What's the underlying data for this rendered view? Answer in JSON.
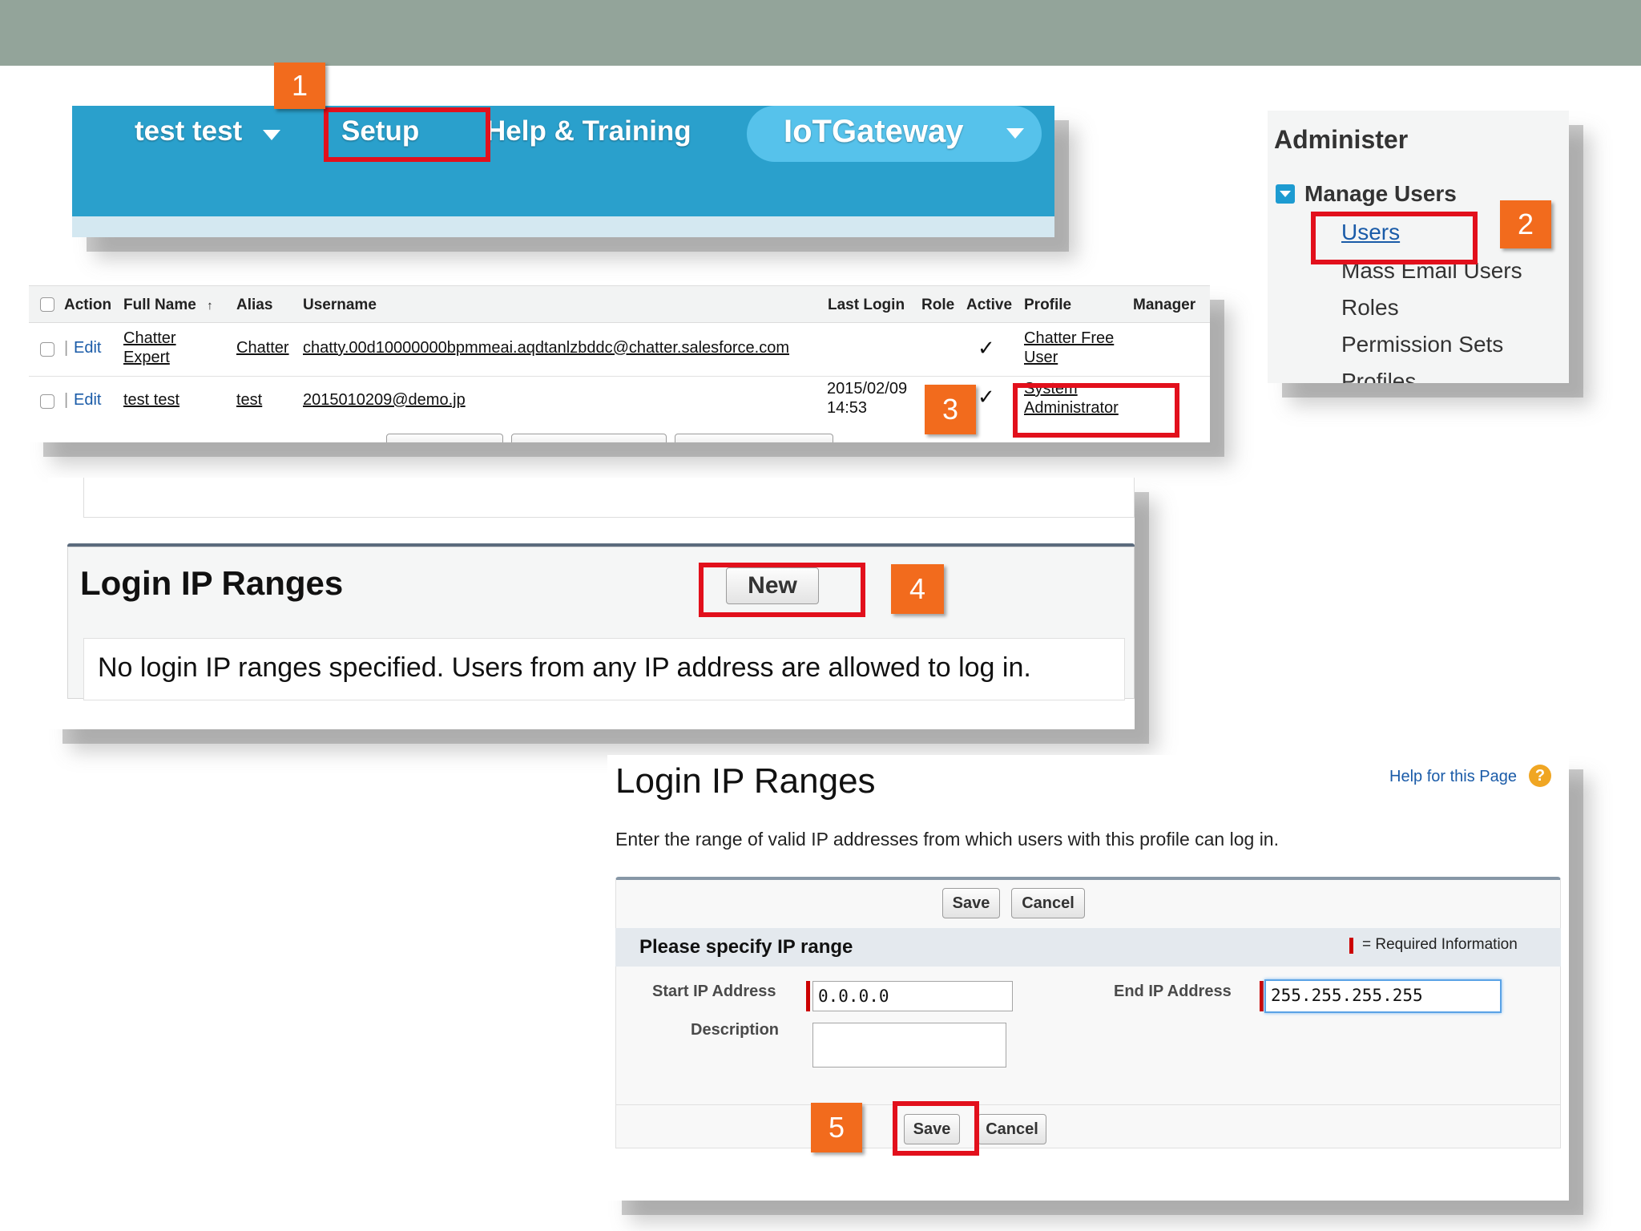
{
  "header": {
    "user_name": "test test",
    "setup_label": "Setup",
    "help_training_label": "Help & Training",
    "app_name": "IoTGateway"
  },
  "callouts": [
    "1",
    "2",
    "3",
    "4",
    "5"
  ],
  "admin_panel": {
    "title": "Administer",
    "section": "Manage Users",
    "items": [
      "Users",
      "Mass Email Users",
      "Roles",
      "Permission Sets",
      "Profiles"
    ]
  },
  "users_table": {
    "columns": [
      "Action",
      "Full Name",
      "Alias",
      "Username",
      "Last Login",
      "Role",
      "Active",
      "Profile",
      "Manager"
    ],
    "sort_indicator": "↑",
    "edit_label": "Edit",
    "active_mark": "✓",
    "rows": [
      {
        "full_name_line1": "Chatter",
        "full_name_line2": "Expert",
        "alias": "Chatter",
        "username": "chatty.00d10000000bpmmeai.aqdtanlzbddc@chatter.salesforce.com",
        "last_login_date": "",
        "last_login_time": "",
        "profile_line1": "Chatter Free",
        "profile_line2": "User"
      },
      {
        "full_name_line1": "test test",
        "full_name_line2": "",
        "alias": "test",
        "username": "2015010209@demo.jp",
        "last_login_date": "2015/02/09",
        "last_login_time": "14:53",
        "profile_line1": "System",
        "profile_line2": "Administrator"
      }
    ]
  },
  "login_ip_panel": {
    "title": "Login IP Ranges",
    "new_button": "New",
    "empty_message": "No login IP ranges specified. Users from any IP address are allowed to log in."
  },
  "ip_form": {
    "title": "Login IP Ranges",
    "help_link": "Help for this Page",
    "help_icon_glyph": "?",
    "description": "Enter the range of valid IP addresses from which users with this profile can log in.",
    "save_label": "Save",
    "cancel_label": "Cancel",
    "section_title": "Please specify IP range",
    "required_legend": "= Required Information",
    "start_ip_label": "Start IP Address",
    "start_ip_value": "0.0.0.0",
    "end_ip_label": "End IP Address",
    "end_ip_value": "255.255.255.255",
    "description_label": "Description",
    "description_value": ""
  },
  "colors": {
    "callout": "#f26b1d",
    "highlight": "#e2101c",
    "header_blue": "#2aa0cc",
    "link_blue": "#1a5ba8"
  }
}
